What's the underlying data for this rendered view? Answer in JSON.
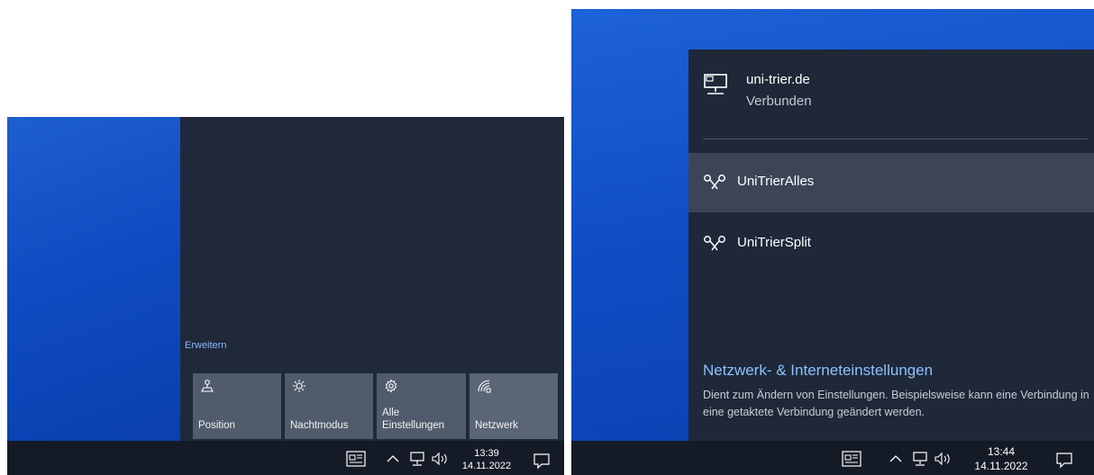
{
  "left": {
    "expand_label": "Erweitern",
    "tiles": [
      {
        "icon": "location-icon",
        "label": "Position"
      },
      {
        "icon": "night-light-icon",
        "label": "Nachtmodus"
      },
      {
        "icon": "settings-gear-icon",
        "label": "Alle Einstellungen"
      },
      {
        "icon": "network-icon",
        "label": "Netzwerk"
      }
    ],
    "taskbar": {
      "time": "13:39",
      "date": "14.11.2022"
    }
  },
  "right": {
    "connection": {
      "name": "uni-trier.de",
      "status": "Verbunden",
      "icon": "ethernet-icon"
    },
    "vpns": [
      {
        "label": "UniTrierAlles",
        "icon": "vpn-icon",
        "selected": true
      },
      {
        "label": "UniTrierSplit",
        "icon": "vpn-icon",
        "selected": false
      }
    ],
    "settings_link": "Netzwerk- & Interneteinstellungen",
    "settings_desc": "Dient zum Ändern von Einstellungen. Beispielsweise kann eine Verbindung in eine getaktete Verbindung geändert werden.",
    "taskbar": {
      "time": "13:44",
      "date": "14.11.2022"
    }
  },
  "colors": {
    "accent_link": "#8cc1ff",
    "flyout_bg": "#1e2838",
    "taskbar_bg": "#141b26",
    "desktop_blue": "#0f4cc2"
  }
}
